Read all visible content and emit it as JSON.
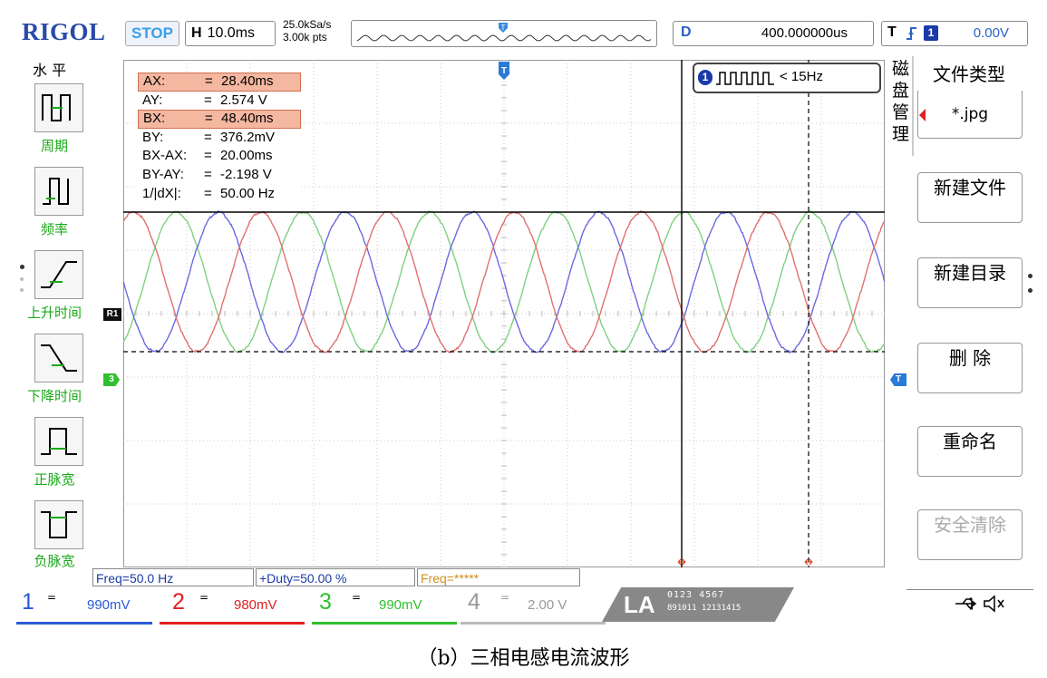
{
  "header": {
    "logo": "RIGOL",
    "run_state": "STOP",
    "timebase_label": "H",
    "timebase_value": "10.0ms",
    "sample_rate": "25.0kSa/s",
    "memory_depth": "3.00k pts",
    "delay_label": "D",
    "delay_value": "400.000000us",
    "trigger_label": "T",
    "trigger_channel": "1",
    "trigger_level": "0.00V"
  },
  "left_menu": {
    "title": "水 平",
    "items": [
      {
        "label": "周期",
        "icon": "period-icon"
      },
      {
        "label": "频率",
        "icon": "frequency-icon"
      },
      {
        "label": "上升时间",
        "icon": "rise-time-icon"
      },
      {
        "label": "下降时间",
        "icon": "fall-time-icon"
      },
      {
        "label": "正脉宽",
        "icon": "positive-width-icon"
      },
      {
        "label": "负脉宽",
        "icon": "negative-width-icon"
      }
    ]
  },
  "cursor_readout": [
    {
      "name": "AX:",
      "value": "28.40ms",
      "highlight": true
    },
    {
      "name": "AY:",
      "value": "2.574 V",
      "highlight": false
    },
    {
      "name": "BX:",
      "value": "48.40ms",
      "highlight": true
    },
    {
      "name": "BY:",
      "value": "376.2mV",
      "highlight": false
    },
    {
      "name": "BX-AX:",
      "value": "20.00ms",
      "highlight": false
    },
    {
      "name": "BY-AY:",
      "value": "-2.198 V",
      "highlight": false
    },
    {
      "name": "1/|dX|:",
      "value": "50.00 Hz",
      "highlight": false
    }
  ],
  "trigger_badge": {
    "channel": "1",
    "condition": "< 15Hz"
  },
  "screen_markers": {
    "trigger_pos": "T",
    "ref_marker": "R1",
    "ch3_marker": "3",
    "trig_level_marker": "T"
  },
  "right_menu": {
    "title_chars": [
      "磁",
      "盘",
      "管",
      "理"
    ],
    "file_type_label": "文件类型",
    "file_type_value": "*.jpg",
    "new_file": "新建文件",
    "new_dir": "新建目录",
    "delete": "删 除",
    "rename": "重命名",
    "secure_erase": "安全清除"
  },
  "measurements": {
    "freq": "Freq=50.0 Hz",
    "duty": "+Duty=50.00 %",
    "freq2": "Freq=*****"
  },
  "channels": [
    {
      "num": "1",
      "coupling": "=",
      "scale": "990mV",
      "color": "#2a5ad8"
    },
    {
      "num": "2",
      "coupling": "=",
      "scale": "980mV",
      "color": "#e02020"
    },
    {
      "num": "3",
      "coupling": "=",
      "scale": "990mV",
      "color": "#30c030"
    },
    {
      "num": "4",
      "coupling": "=",
      "scale": "2.00 V",
      "color": "#999999"
    }
  ],
  "la": {
    "label": "LA",
    "row1": "0123 4567",
    "row2": "891011 12131415"
  },
  "caption": "（b）三相电感电流波形",
  "colors": {
    "screen_bg": "#ffffff",
    "grid": "#c8c8c8",
    "wave_ch1": "#6a6ae0",
    "wave_ch2": "#e07070",
    "wave_ch3": "#80d080",
    "accent_blue": "#2a60c8",
    "green_label": "#1aaa1a"
  }
}
